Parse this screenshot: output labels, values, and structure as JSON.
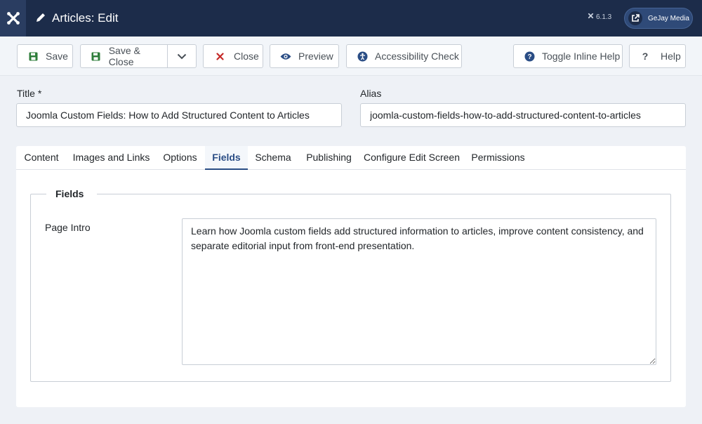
{
  "header": {
    "title": "Articles: Edit",
    "version": "6.1.3",
    "site_label": "GeJay Media"
  },
  "toolbar": {
    "save": "Save",
    "save_close": "Save & Close",
    "close": "Close",
    "preview": "Preview",
    "accessibility": "Accessibility Check",
    "inline_help": "Toggle Inline Help",
    "help": "Help"
  },
  "form": {
    "title_label": "Title *",
    "title_value": "Joomla Custom Fields: How to Add Structured Content to Articles",
    "alias_label": "Alias",
    "alias_value": "joomla-custom-fields-how-to-add-structured-content-to-articles"
  },
  "tabs": [
    {
      "label": "Content"
    },
    {
      "label": "Images and Links"
    },
    {
      "label": "Options"
    },
    {
      "label": "Fields",
      "active": true
    },
    {
      "label": "Schema"
    },
    {
      "label": "Publishing"
    },
    {
      "label": "Configure Edit Screen"
    },
    {
      "label": "Permissions"
    }
  ],
  "fields": {
    "legend": "Fields",
    "page_intro_label": "Page Intro",
    "page_intro_value": "Learn how Joomla custom fields add structured information to articles, improve content consistency, and separate editorial input from front-end presentation."
  },
  "colors": {
    "header_bg": "#1c2c4a",
    "save_green": "#2e7d3a",
    "close_red": "#c52827",
    "accent_blue": "#2a4d85"
  }
}
